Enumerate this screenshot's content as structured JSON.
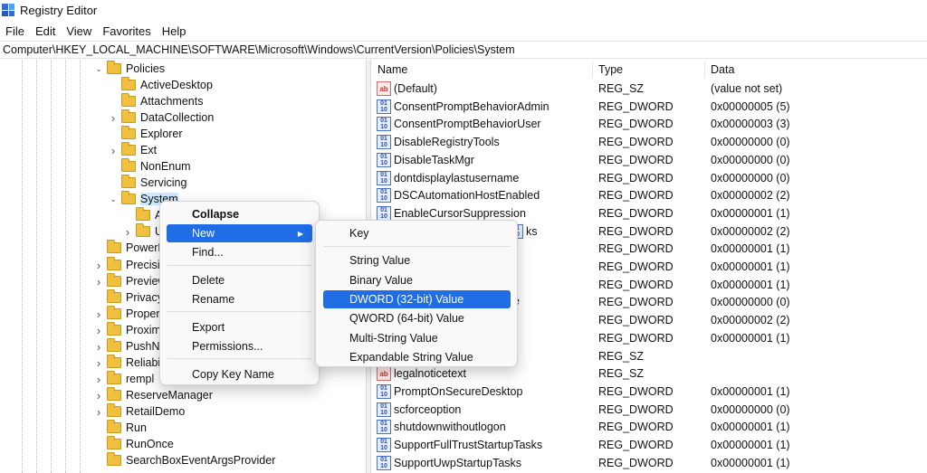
{
  "window": {
    "title": "Registry Editor"
  },
  "menubar": [
    "File",
    "Edit",
    "View",
    "Favorites",
    "Help"
  ],
  "address": "Computer\\HKEY_LOCAL_MACHINE\\SOFTWARE\\Microsoft\\Windows\\CurrentVersion\\Policies\\System",
  "tree": {
    "items": [
      {
        "label": "Policies",
        "expander": "collapse"
      },
      {
        "label": "ActiveDesktop",
        "expander": ""
      },
      {
        "label": "Attachments",
        "expander": ""
      },
      {
        "label": "DataCollection",
        "expander": "expand"
      },
      {
        "label": "Explorer",
        "expander": ""
      },
      {
        "label": "Ext",
        "expander": "expand"
      },
      {
        "label": "NonEnum",
        "expander": ""
      },
      {
        "label": "Servicing",
        "expander": ""
      },
      {
        "label": "System",
        "expander": "collapse"
      },
      {
        "label": "A",
        "expander": ""
      },
      {
        "label": "U",
        "expander": "expand"
      },
      {
        "label": "PowerE",
        "expander": ""
      },
      {
        "label": "Precisio",
        "expander": "expand"
      },
      {
        "label": "Preview",
        "expander": "expand"
      },
      {
        "label": "Privacy",
        "expander": ""
      },
      {
        "label": "Proper",
        "expander": "expand"
      },
      {
        "label": "Proxim",
        "expander": "expand"
      },
      {
        "label": "PushNo",
        "expander": "expand"
      },
      {
        "label": "Reliabi",
        "expander": "expand"
      },
      {
        "label": "rempl",
        "expander": "expand"
      },
      {
        "label": "ReserveManager",
        "expander": "expand"
      },
      {
        "label": "RetailDemo",
        "expander": "expand"
      },
      {
        "label": "Run",
        "expander": ""
      },
      {
        "label": "RunOnce",
        "expander": ""
      },
      {
        "label": "SearchBoxEventArgsProvider",
        "expander": ""
      }
    ]
  },
  "list": {
    "columns": {
      "name": "Name",
      "type": "Type",
      "data": "Data"
    },
    "rows": [
      {
        "icon": "string-value-icon",
        "name": "(Default)",
        "type": "REG_SZ",
        "data": "(value not set)"
      },
      {
        "icon": "binary-value-icon",
        "name": "ConsentPromptBehaviorAdmin",
        "type": "REG_DWORD",
        "data": "0x00000005 (5)"
      },
      {
        "icon": "binary-value-icon",
        "name": "ConsentPromptBehaviorUser",
        "type": "REG_DWORD",
        "data": "0x00000003 (3)"
      },
      {
        "icon": "binary-value-icon",
        "name": "DisableRegistryTools",
        "type": "REG_DWORD",
        "data": "0x00000000 (0)"
      },
      {
        "icon": "binary-value-icon",
        "name": "DisableTaskMgr",
        "type": "REG_DWORD",
        "data": "0x00000000 (0)"
      },
      {
        "icon": "binary-value-icon",
        "name": "dontdisplaylastusername",
        "type": "REG_DWORD",
        "data": "0x00000000 (0)"
      },
      {
        "icon": "binary-value-icon",
        "name": "DSCAutomationHostEnabled",
        "type": "REG_DWORD",
        "data": "0x00000002 (2)"
      },
      {
        "icon": "binary-value-icon",
        "name": "EnableCursorSuppression",
        "type": "REG_DWORD",
        "data": "0x00000001 (1)"
      },
      {
        "icon": "binary-value-icon",
        "name": "ks",
        "type": "REG_DWORD",
        "data": "0x00000002 (2)"
      },
      {
        "icon": "",
        "name": "",
        "type": "REG_DWORD",
        "data": "0x00000001 (1)"
      },
      {
        "icon": "",
        "name": "",
        "type": "REG_DWORD",
        "data": "0x00000001 (1)"
      },
      {
        "icon": "",
        "name": "",
        "type": "REG_DWORD",
        "data": "0x00000001 (1)"
      },
      {
        "icon": "",
        "name": "e",
        "type": "REG_DWORD",
        "data": "0x00000000 (0)"
      },
      {
        "icon": "",
        "name": "",
        "type": "REG_DWORD",
        "data": "0x00000002 (2)"
      },
      {
        "icon": "",
        "name": "",
        "type": "REG_DWORD",
        "data": "0x00000001 (1)"
      },
      {
        "icon": "",
        "name": "",
        "type": "REG_SZ",
        "data": ""
      },
      {
        "icon": "string-value-icon",
        "name": "legalnoticetext",
        "type": "REG_SZ",
        "data": ""
      },
      {
        "icon": "binary-value-icon",
        "name": "PromptOnSecureDesktop",
        "type": "REG_DWORD",
        "data": "0x00000001 (1)"
      },
      {
        "icon": "binary-value-icon",
        "name": "scforceoption",
        "type": "REG_DWORD",
        "data": "0x00000000 (0)"
      },
      {
        "icon": "binary-value-icon",
        "name": "shutdownwithoutlogon",
        "type": "REG_DWORD",
        "data": "0x00000001 (1)"
      },
      {
        "icon": "binary-value-icon",
        "name": "SupportFullTrustStartupTasks",
        "type": "REG_DWORD",
        "data": "0x00000001 (1)"
      },
      {
        "icon": "binary-value-icon",
        "name": "SupportUwpStartupTasks",
        "type": "REG_DWORD",
        "data": "0x00000001 (1)"
      }
    ]
  },
  "context_menu": {
    "items": [
      "Collapse",
      "New",
      "Find...",
      "Delete",
      "Rename",
      "Export",
      "Permissions...",
      "Copy Key Name"
    ],
    "highlighted": "New"
  },
  "submenu": {
    "items": [
      "Key",
      "String Value",
      "Binary Value",
      "DWORD (32-bit) Value",
      "QWORD (64-bit) Value",
      "Multi-String Value",
      "Expandable String Value"
    ],
    "highlighted": "DWORD (32-bit) Value"
  },
  "colors": {
    "highlight": "#1f6ee6",
    "selection": "#cde8ff",
    "folder": "#f0c040"
  }
}
